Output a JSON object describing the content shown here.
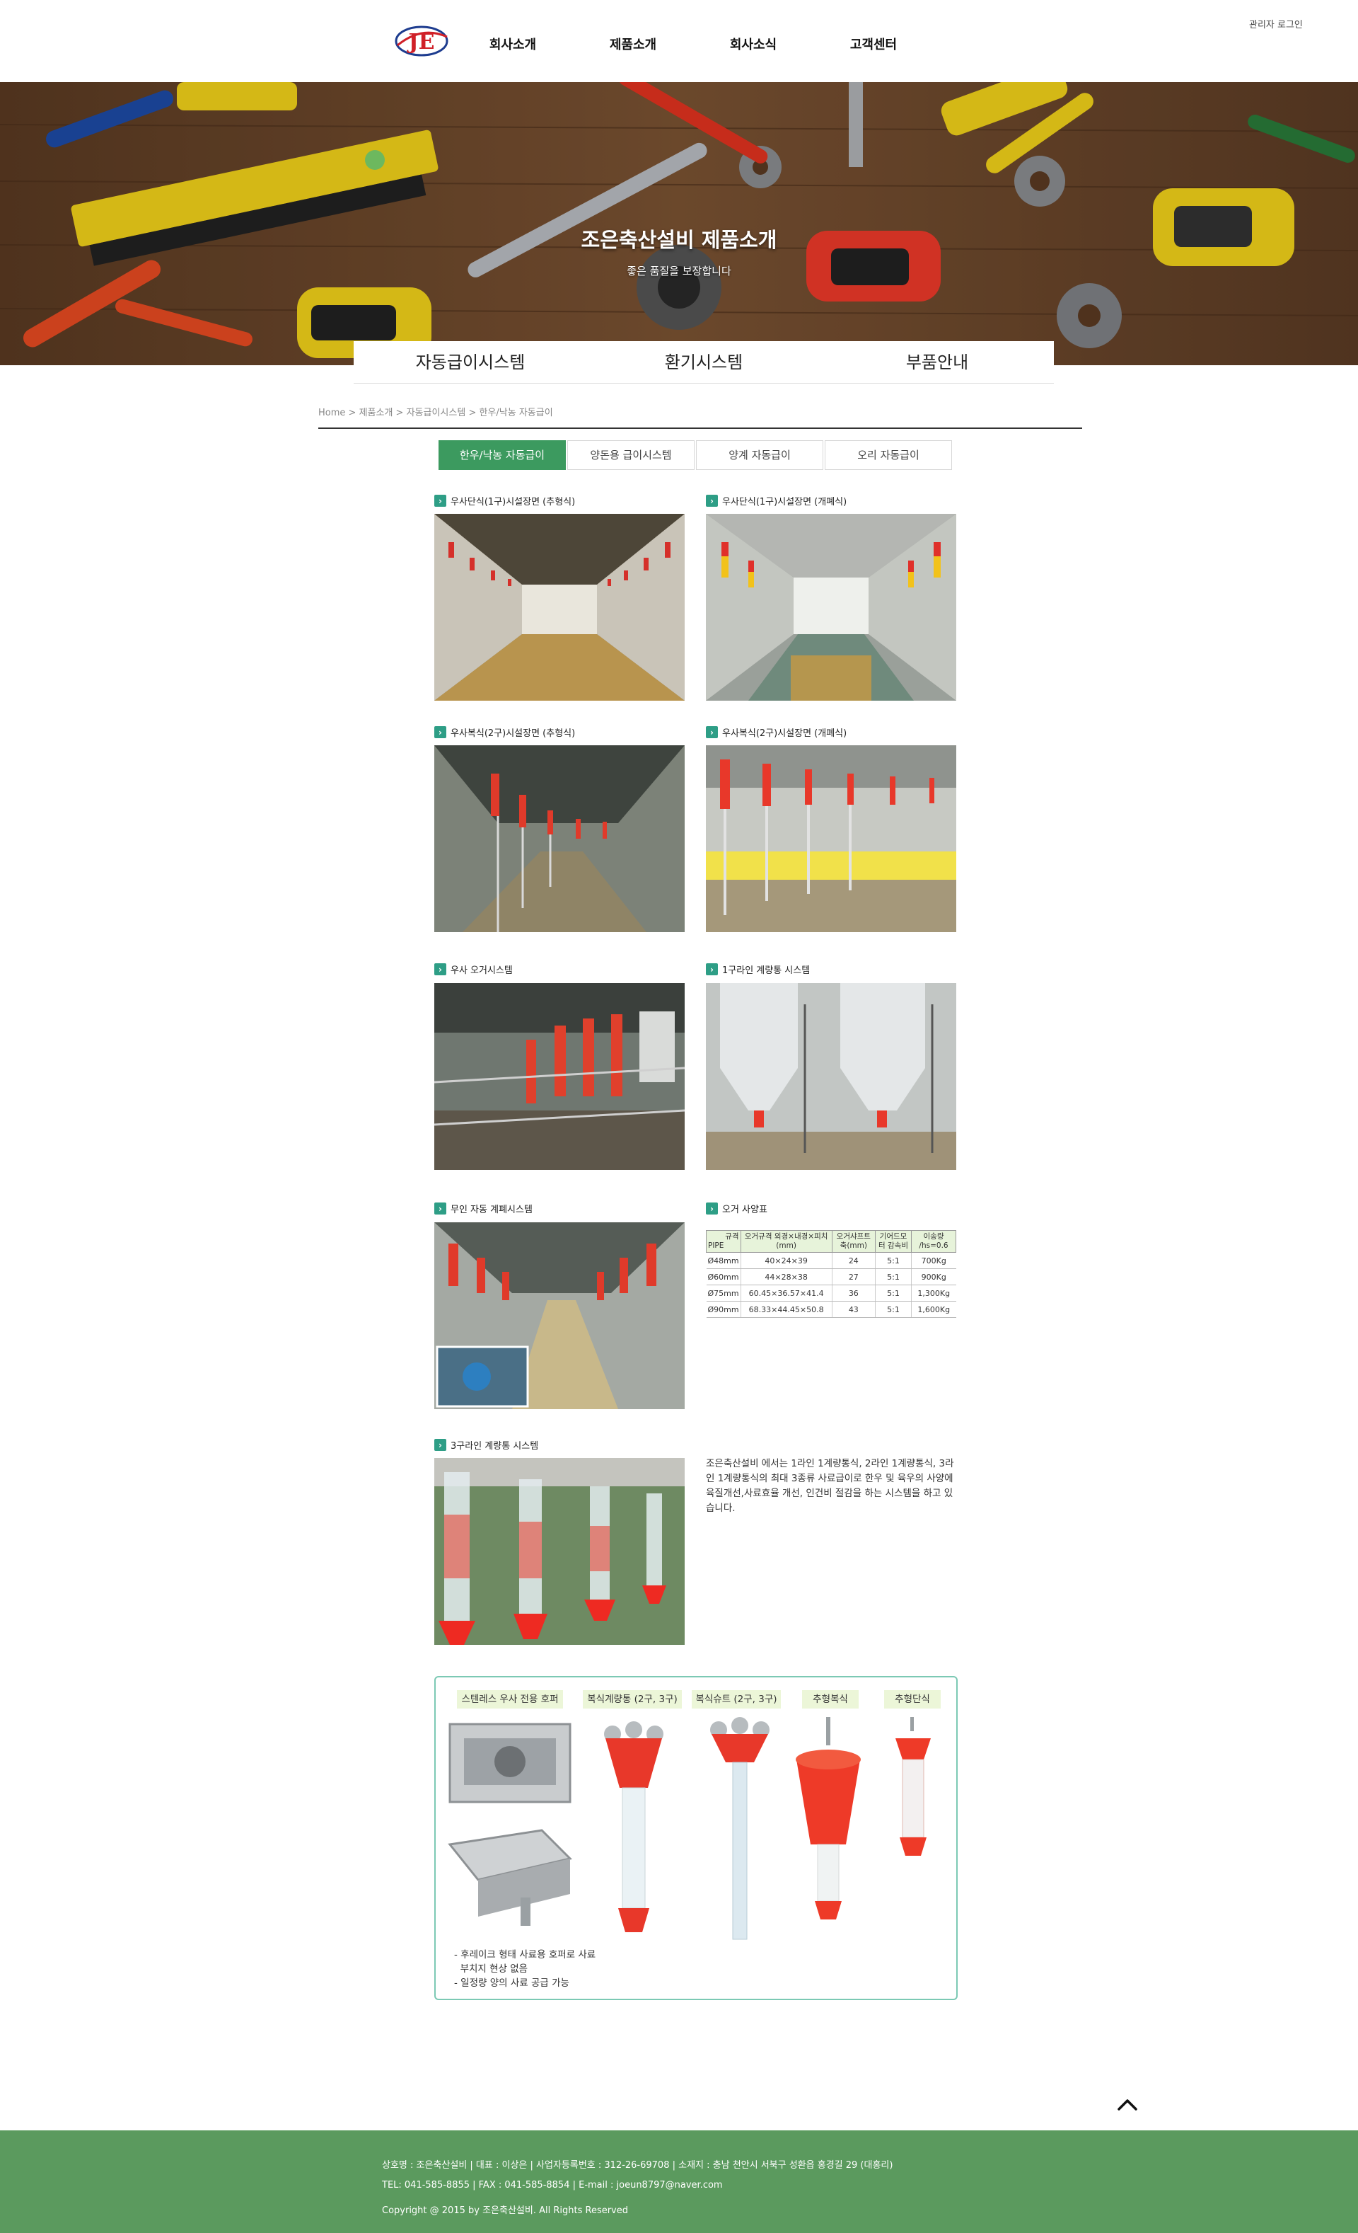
{
  "header": {
    "logo_text": "JE",
    "nav": [
      "회사소개",
      "제품소개",
      "회사소식",
      "고객센터"
    ],
    "admin_login": "관리자 로그인"
  },
  "hero": {
    "title": "조은축산설비 제품소개",
    "subtitle": "좋은 품질을 보장합니다"
  },
  "subnav": [
    "자동급이시스템",
    "환기시스템",
    "부품안내"
  ],
  "breadcrumb": [
    "Home",
    "제품소개",
    "자동급이시스템",
    "한우/낙농 자동급이"
  ],
  "tabs": [
    {
      "label": "한우/낙농 자동급이",
      "active": true
    },
    {
      "label": "양돈용 급이시스템",
      "active": false
    },
    {
      "label": "양계 자동급이",
      "active": false
    },
    {
      "label": "오리 자동급이",
      "active": false
    }
  ],
  "items": [
    {
      "label": "우사단식(1구)시설장면 (추형식)"
    },
    {
      "label": "우사단식(1구)시설장면 (개폐식)"
    },
    {
      "label": "우사복식(2구)시설장면 (추형식)"
    },
    {
      "label": "우사복식(2구)시설장면 (개폐식)"
    },
    {
      "label": "우사 오거시스템"
    },
    {
      "label": "1구라인 계량통 시스템"
    },
    {
      "label": "무인 자동 계폐시스템"
    },
    {
      "label": "오거 사양표"
    },
    {
      "label": "3구라인 계량통 시스템"
    }
  ],
  "spec_table": {
    "header_corner_top": "규격",
    "header_corner_bottom": "PIPE",
    "headers": [
      "오거규격 외경×내경×피치(mm)",
      "오거샤프트 축(mm)",
      "기어드모터 감속비",
      "이송량 /hs=0.6"
    ],
    "rows": [
      [
        "Ø48mm",
        "40×24×39",
        "24",
        "5:1",
        "700Kg"
      ],
      [
        "Ø60mm",
        "44×28×38",
        "27",
        "5:1",
        "900Kg"
      ],
      [
        "Ø75mm",
        "60.45×36.57×41.4",
        "36",
        "5:1",
        "1,300Kg"
      ],
      [
        "Ø90mm",
        "68.33×44.45×50.8",
        "43",
        "5:1",
        "1,600Kg"
      ]
    ]
  },
  "description": "조은축산설비 에서는 1라인 1계량통식, 2라인 1계량통식, 3라인 1계량통식의 최대 3종류 사료급이로 한우 및 육우의 사양에 육질개선,사료효율 개선, 인건비 절감을 하는 시스템을 하고 있습니다.",
  "parts": {
    "labels": [
      "스텐레스 우사 전용 호퍼",
      "복식계량통 (2구, 3구)",
      "복식슈트 (2구, 3구)",
      "추형복식",
      "추형단식"
    ],
    "notes": [
      "- 후레이크 형태 사료용 호퍼로 사료",
      "  부치지 현상 없음",
      "- 일정량 양의 사료 공급 가능"
    ]
  },
  "footer": {
    "line1": "상호명 : 조은축산설비 | 대표 : 이상은 | 사업자등록번호 : 312-26-69708 | 소재지 : 충남 천안시 서북구 성환읍 홍경길 29 (대홍리)",
    "line2": "TEL: 041-585-8855 | FAX : 041-585-8854 | E-mail : joeun8797@naver.com",
    "line3": "Copyright @ 2015 by 조은축산설비. All Rights Reserved"
  },
  "colors": {
    "accent_green": "#3c9a5f",
    "footer_green": "#5b9a5e",
    "bullet_teal": "#2e9e86",
    "feeder_red": "#e8382a"
  }
}
